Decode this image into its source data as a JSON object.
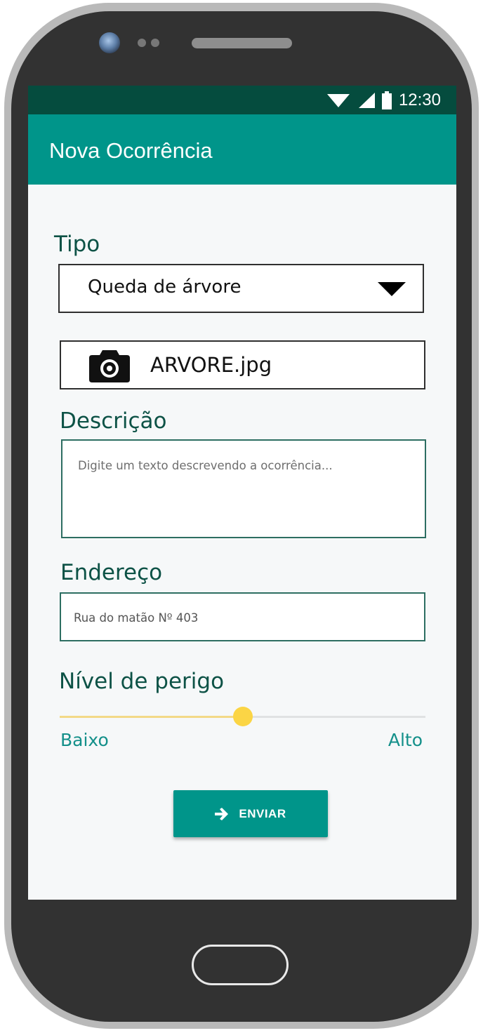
{
  "statusbar": {
    "time": "12:30",
    "icons": [
      "wifi-icon",
      "signal-icon",
      "battery-icon"
    ]
  },
  "appbar": {
    "title": "Nova Ocorrência"
  },
  "form": {
    "tipo": {
      "label": "Tipo",
      "selected": "Queda de árvore"
    },
    "foto": {
      "icon": "camera-icon",
      "file_name": "ARVORE.jpg"
    },
    "descricao": {
      "label": "Descrição",
      "placeholder": "Digite um texto descrevendo a ocorrência..."
    },
    "endereco": {
      "label": "Endereço",
      "value": "Rua do matão Nº 403"
    },
    "nivel_perigo": {
      "label": "Nível de perigo",
      "min_label": "Baixo",
      "max_label": "Alto",
      "value_fraction": 0.5
    },
    "submit": {
      "label": "ENVIAR",
      "icon": "arrow-right-icon"
    }
  },
  "colors": {
    "primary": "#00958a",
    "status_bar": "#054c3e",
    "label_text": "#0d5246",
    "slider_thumb": "#fbd545",
    "slider_fill": "#f3d987"
  }
}
